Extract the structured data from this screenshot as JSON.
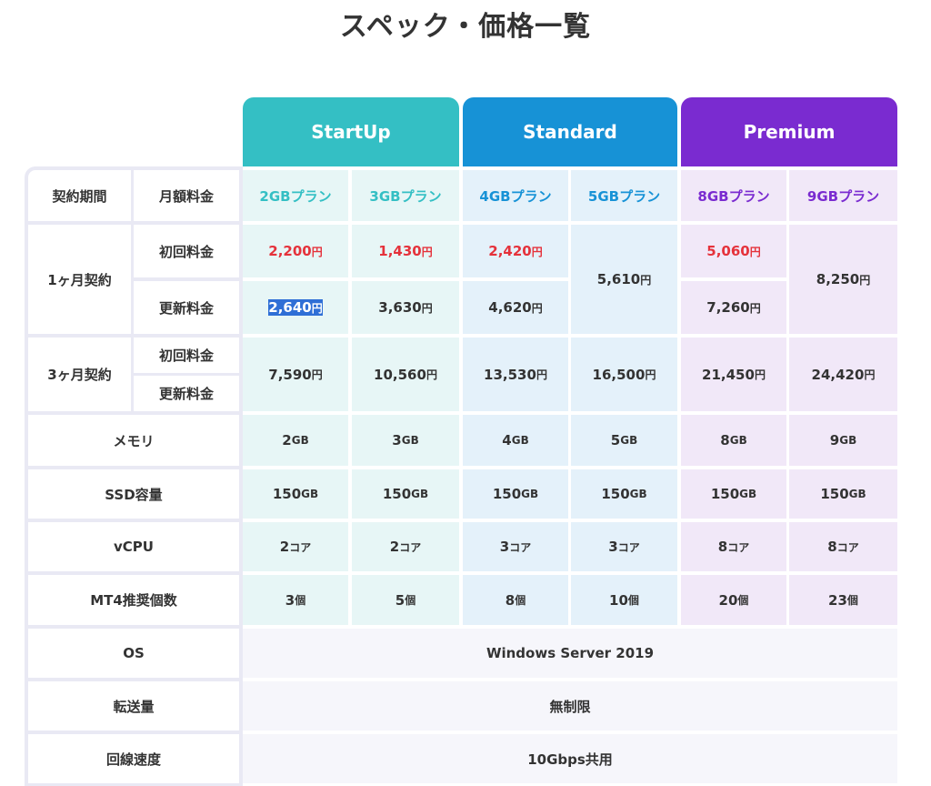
{
  "title": "スペック・価格一覧",
  "colors": {
    "startup": "#34bfc4",
    "standard": "#1792d6",
    "premium": "#7a2bd0",
    "price_red": "#e5323b"
  },
  "plans_header": [
    {
      "name": "StartUp"
    },
    {
      "name": "Standard"
    },
    {
      "name": "Premium"
    }
  ],
  "table": {
    "contract_period": "契約期間",
    "monthly_fee": "月額料金",
    "plans": [
      "2GBプラン",
      "3GBプラン",
      "4GBプラン",
      "5GBプラン",
      "8GBプラン",
      "9GBプラン"
    ],
    "one_month": "1ヶ月契約",
    "three_month": "3ヶ月契約",
    "initial": "初回料金",
    "renewal": "更新料金",
    "yen": "円",
    "m1_initial": [
      "2,200",
      "1,430",
      "2,420",
      "5,610",
      "5,060",
      "8,250"
    ],
    "m1_renewal": [
      "2,640",
      "3,630",
      "4,620",
      "7,260"
    ],
    "m3": [
      "7,590",
      "10,560",
      "13,530",
      "16,500",
      "21,450",
      "24,420"
    ],
    "memory_label": "メモリ",
    "memory": [
      "2",
      "3",
      "4",
      "5",
      "8",
      "9"
    ],
    "ssd_label": "SSD容量",
    "ssd": [
      "150",
      "150",
      "150",
      "150",
      "150",
      "150"
    ],
    "gb": "GB",
    "vcpu_label": "vCPU",
    "vcpu": [
      "2",
      "2",
      "3",
      "3",
      "8",
      "8"
    ],
    "core": "コア",
    "mt4_label": "MT4推奨個数",
    "mt4": [
      "3",
      "5",
      "8",
      "10",
      "20",
      "23"
    ],
    "ko": "個",
    "os_label": "OS",
    "os": "Windows Server 2019",
    "transfer_label": "転送量",
    "transfer": "無制限",
    "line_label": "回線速度",
    "line": "10Gbps共用"
  }
}
